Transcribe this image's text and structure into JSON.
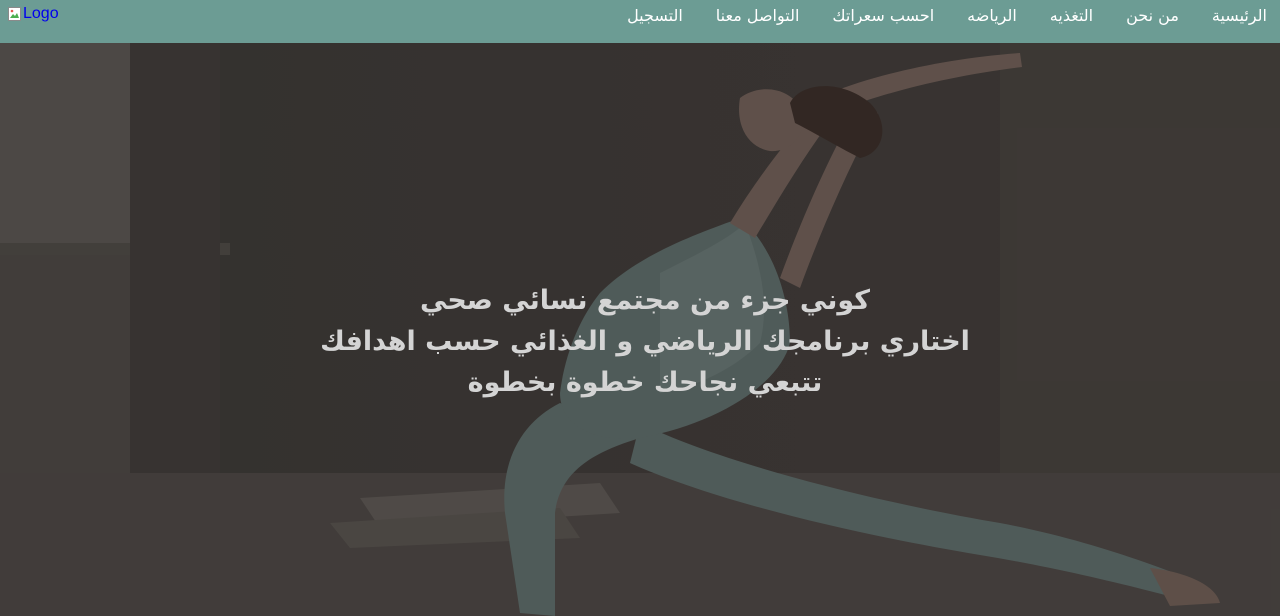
{
  "navbar": {
    "logo_alt": "Logo",
    "links": [
      "الرئيسية",
      "من نحن",
      "التغذيه",
      "الرياضه",
      "احسب سعراتك",
      "التواصل معنا",
      "التسجيل"
    ],
    "background_color": "#6c9c94"
  },
  "hero": {
    "lines": [
      "كوني جزء من مجتمع نسائي صحي",
      "اختاري برنامجك الرياضي و الغذائي حسب اهدافك",
      "تتبعي نجاحك خطوة بخطوة"
    ],
    "background_image": "woman-yoga-lunge-photo"
  }
}
